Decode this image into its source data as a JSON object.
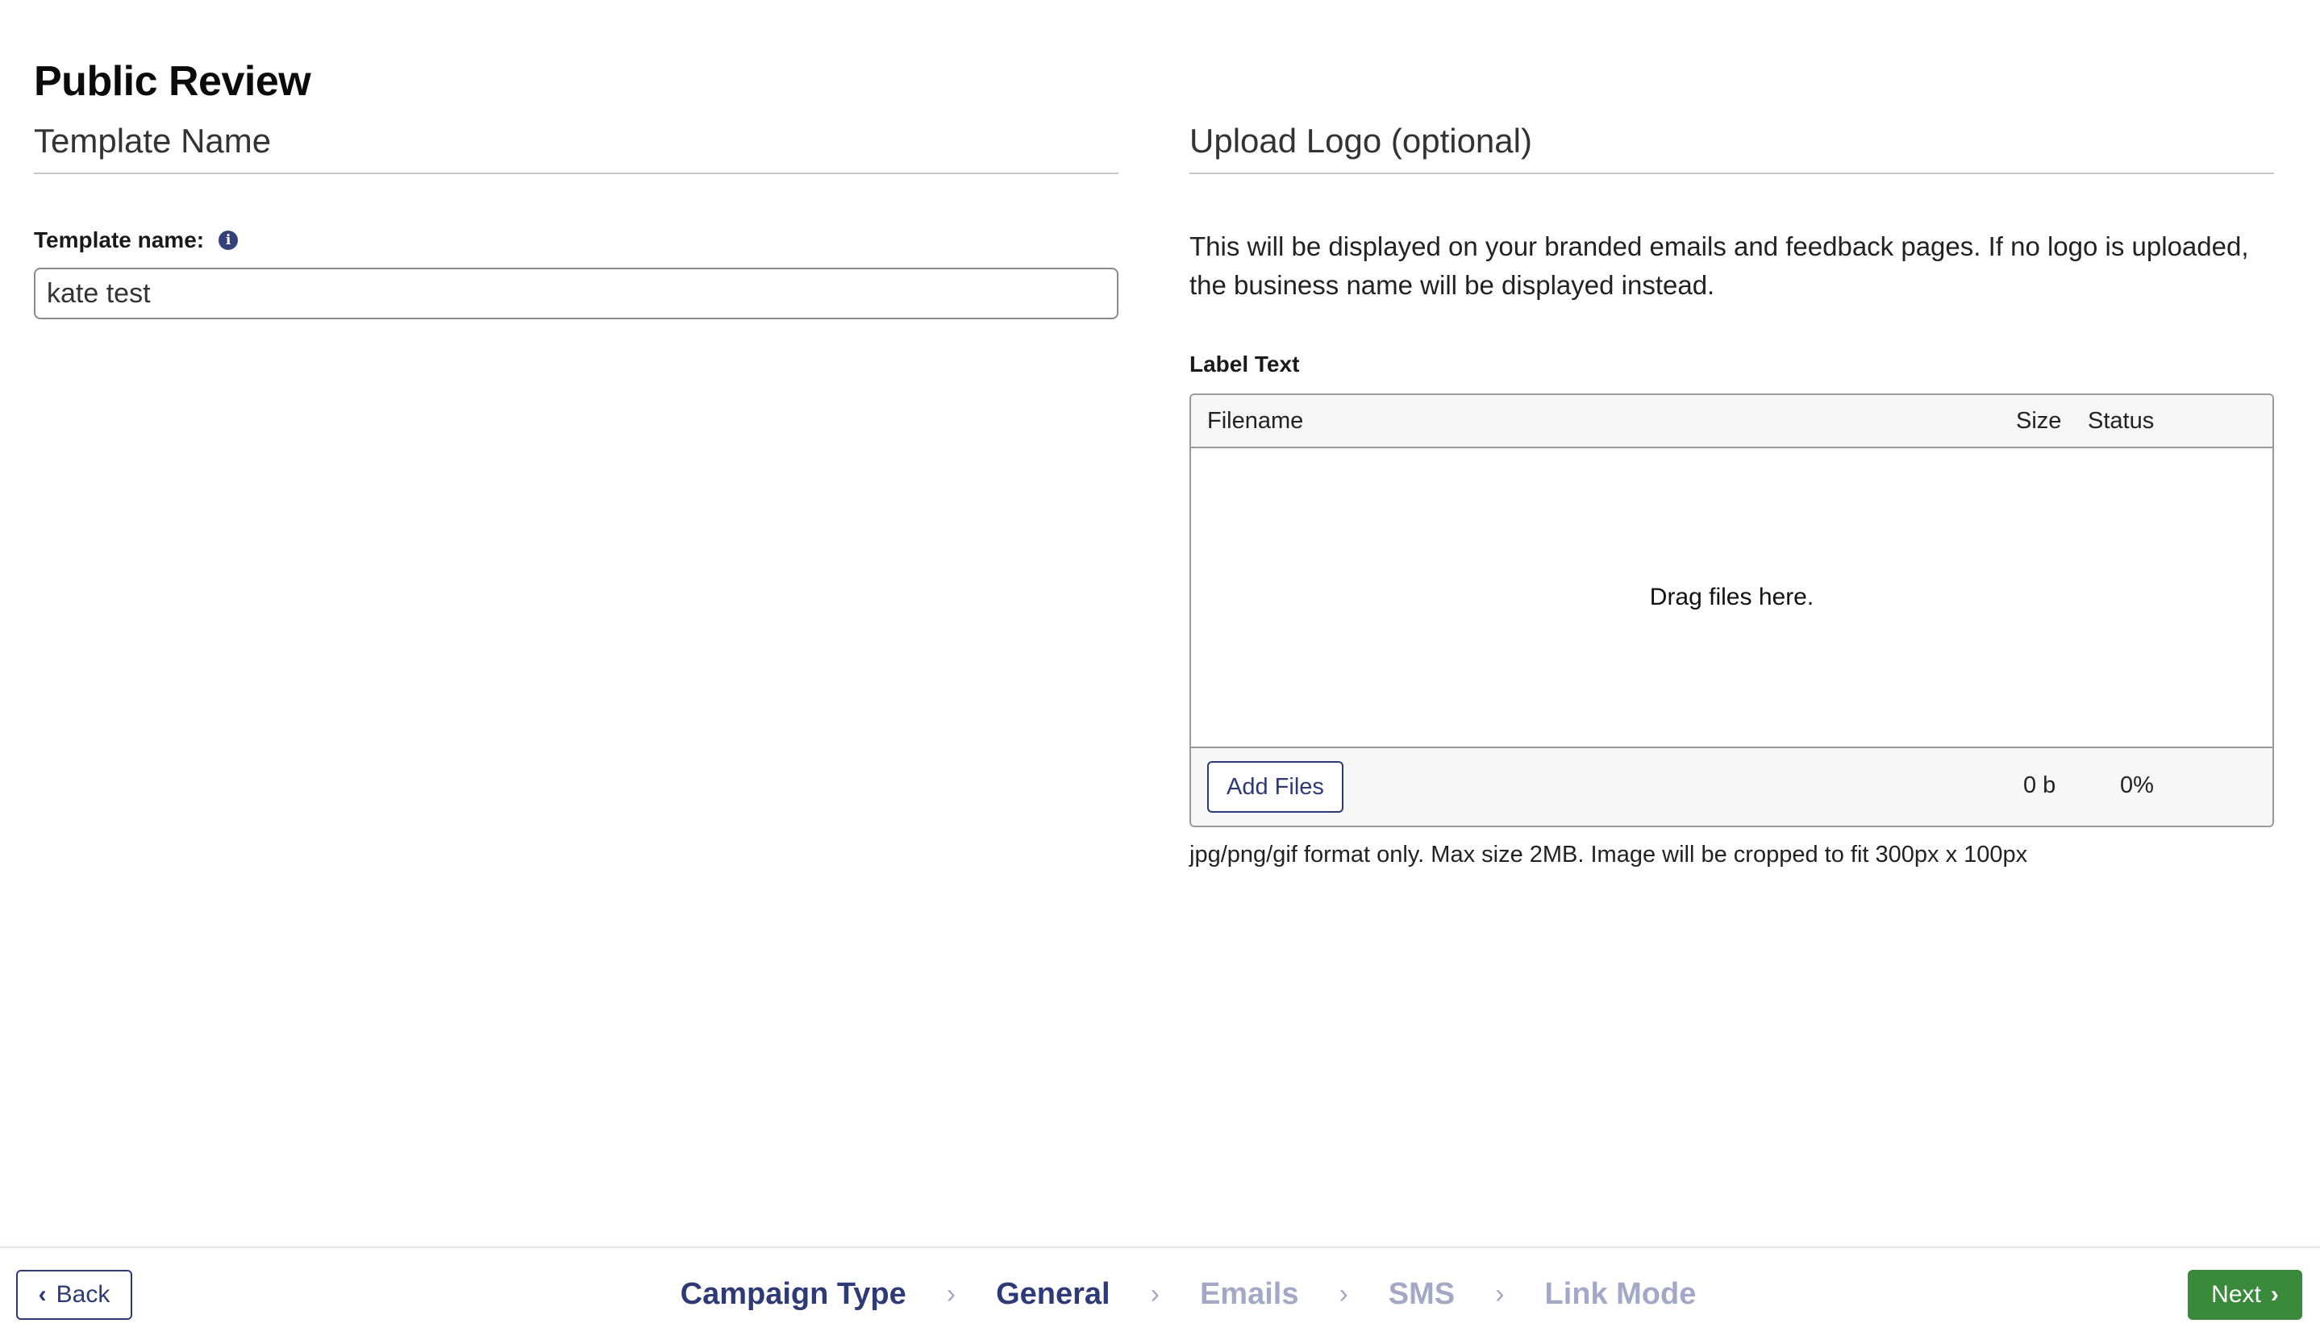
{
  "page": {
    "title": "Public Review"
  },
  "template_section": {
    "heading": "Template Name",
    "field_label": "Template name:",
    "info_icon": "info-icon",
    "input_value": "kate test"
  },
  "logo_section": {
    "heading": "Upload Logo (optional)",
    "description": "This will be displayed on your branded emails and feedback pages. If no logo is uploaded, the business name will be displayed instead.",
    "label_text": "Label Text",
    "uploader": {
      "columns": {
        "filename": "Filename",
        "size": "Size",
        "status": "Status"
      },
      "drop_text": "Drag files here.",
      "add_files_label": "Add Files",
      "total_size": "0 b",
      "total_status": "0%"
    },
    "hint": "jpg/png/gif format only. Max size 2MB. Image will be cropped to fit 300px x 100px"
  },
  "footer": {
    "back_label": "Back",
    "next_label": "Next",
    "steps": [
      {
        "label": "Campaign Type",
        "state": "done"
      },
      {
        "label": "General",
        "state": "done"
      },
      {
        "label": "Emails",
        "state": "pending"
      },
      {
        "label": "SMS",
        "state": "pending"
      },
      {
        "label": "Link Mode",
        "state": "pending"
      }
    ]
  },
  "colors": {
    "accent": "#2e3a78",
    "pending_step": "#a3a8c7",
    "next_button": "#3a8a3c"
  }
}
